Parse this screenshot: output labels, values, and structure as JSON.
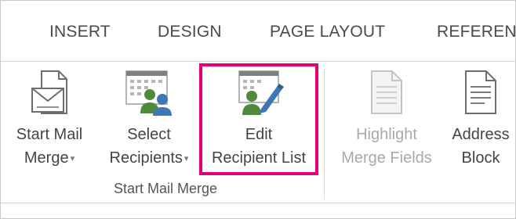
{
  "tabs": [
    {
      "label": "INSERT"
    },
    {
      "label": "DESIGN"
    },
    {
      "label": "PAGE LAYOUT"
    },
    {
      "label": "REFERENCES"
    }
  ],
  "ribbon": {
    "buttons": [
      {
        "line1": "Start Mail",
        "line2": "Merge",
        "dropdown": true,
        "icon": "envelope-document-icon",
        "enabled": true
      },
      {
        "line1": "Select",
        "line2": "Recipients",
        "dropdown": true,
        "icon": "select-recipients-icon",
        "enabled": true
      },
      {
        "line1": "Edit",
        "line2": "Recipient List",
        "dropdown": false,
        "icon": "edit-recipient-list-icon",
        "enabled": true,
        "highlighted": true
      },
      {
        "line1": "Highlight",
        "line2": "Merge Fields",
        "dropdown": false,
        "icon": "highlight-merge-fields-icon",
        "enabled": false
      },
      {
        "line1": "Address",
        "line2": "Block",
        "dropdown": false,
        "icon": "address-block-icon",
        "enabled": true
      }
    ],
    "group_label": "Start Mail Merge",
    "dropdown_glyph": "▾"
  },
  "colors": {
    "highlight_border": "#e3007b",
    "people_green": "#4f8a3a",
    "people_blue": "#3d78b5",
    "calendar_header": "#7f7f7f"
  }
}
